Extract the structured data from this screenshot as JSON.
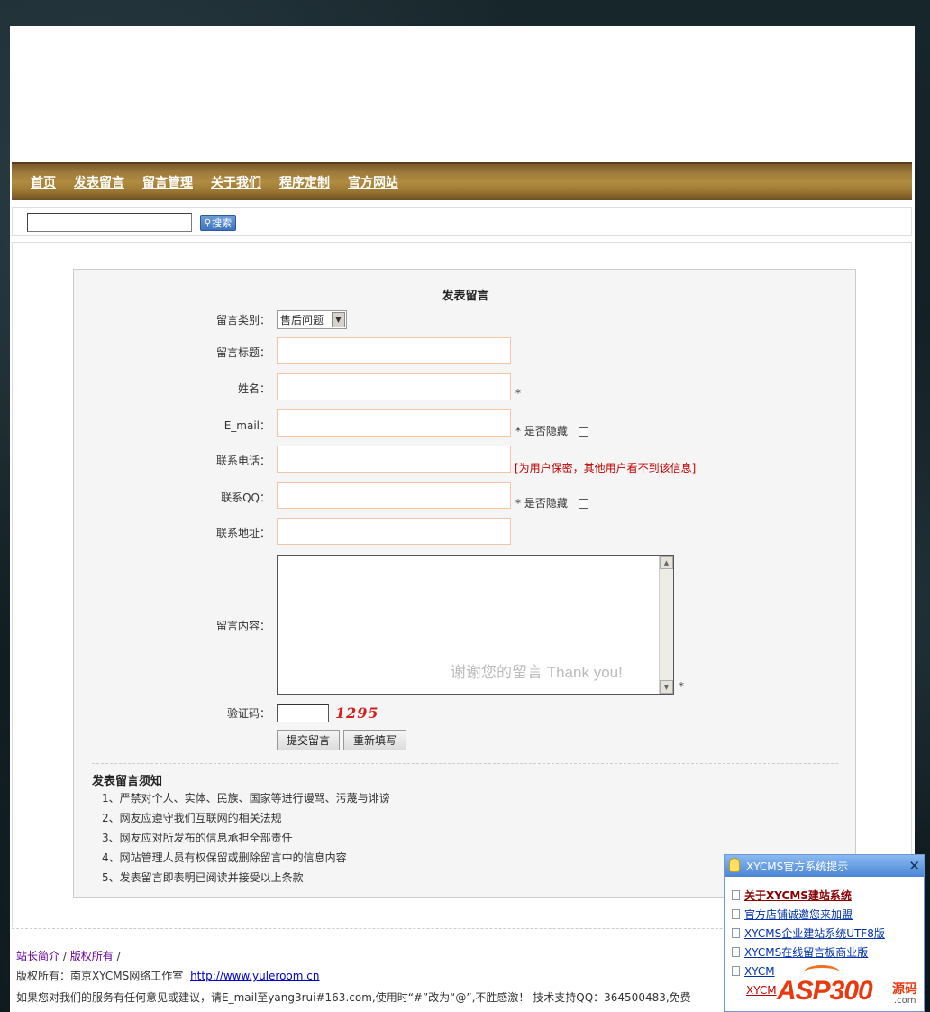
{
  "nav": {
    "items": [
      "首页",
      "发表留言",
      "留言管理",
      "关于我们",
      "程序定制",
      "官方网站"
    ]
  },
  "search": {
    "value": "",
    "button_label": "搜索"
  },
  "form": {
    "title": "发表留言",
    "category_label": "留言类别：",
    "category_selected": "售后问题",
    "subject_label": "留言标题：",
    "name_label": "姓名：",
    "email_label": "E_mail：",
    "phone_label": "联系电话：",
    "qq_label": "联系QQ：",
    "address_label": "联系地址：",
    "content_label": "留言内容：",
    "content_placeholder": "谢谢您的留言 Thank you!",
    "captcha_label": "验证码：",
    "captcha_text": "1295",
    "required_mark": "*",
    "hide_label": "是否隐藏",
    "phone_note": "[为用户保密，其他用户看不到该信息]",
    "submit_label": "提交留言",
    "reset_label": "重新填写"
  },
  "rules": {
    "title": "发表留言须知",
    "items": [
      "1、严禁对个人、实体、民族、国家等进行谩骂、污蔑与诽谤",
      "2、网友应遵守我们互联网的相关法规",
      "3、网友应对所发布的信息承担全部责任",
      "4、网站管理人员有权保留或删除留言中的信息内容",
      "5、发表留言即表明已阅读并接受以上条款"
    ]
  },
  "footer": {
    "link_intro": "站长简介",
    "link_copyright": "版权所有",
    "separator": "/",
    "copyright_prefix": "版权所有：南京XYCMS网络工作室",
    "site_url": "http://www.yuleroom.cn",
    "contact_line": "如果您对我们的服务有任何意见或建议，请E_mail至yang3rui#163.com,使用时“#”改为“@”,不胜感激！  技术支持QQ：364500483,免费"
  },
  "popup": {
    "title": "XYCMS官方系统提示",
    "close": "✕",
    "items": [
      "关于XYCMS建站系统",
      "官方店铺诚邀您来加盟",
      "XYCMS企业建站系统UTF8版",
      "XYCMS在线留言板商业版",
      "XYCM",
      "XYCM"
    ]
  },
  "watermark": {
    "brand": "ASP300",
    "suffix": "源码",
    "domain": ".com"
  }
}
